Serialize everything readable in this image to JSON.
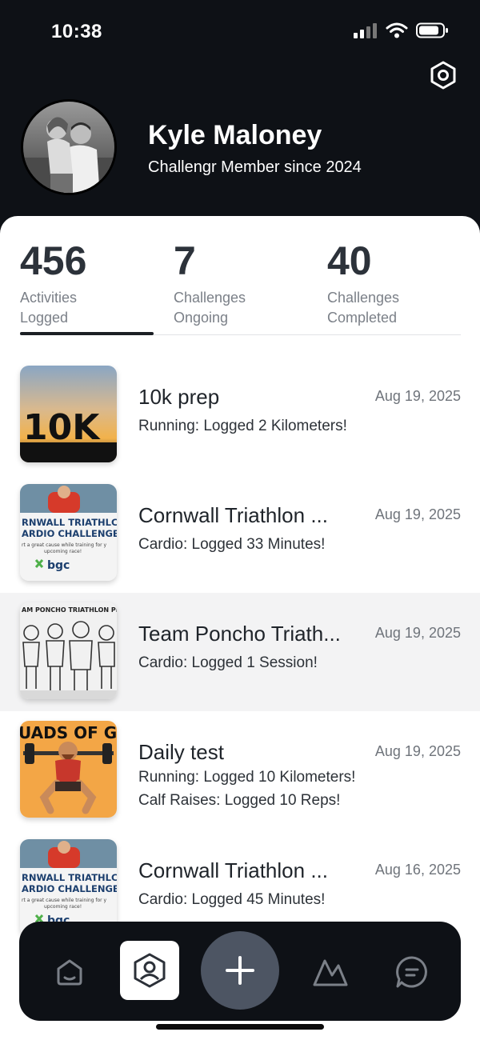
{
  "status_bar": {
    "time": "10:38"
  },
  "profile": {
    "name": "Kyle Maloney",
    "member_since": "Challengr Member since 2024"
  },
  "stats": [
    {
      "value": "456",
      "label": "Activities Logged"
    },
    {
      "value": "7",
      "label": "Challenges Ongoing"
    },
    {
      "value": "40",
      "label": "Challenges Completed"
    }
  ],
  "feed": [
    {
      "title": "10k prep",
      "date": "Aug 19, 2025",
      "lines": [
        "Running: Logged 2 Kilometers!"
      ],
      "thumb_text": "10K"
    },
    {
      "title": "Cornwall Triathlon ...",
      "date": "Aug 19, 2025",
      "lines": [
        "Cardio: Logged 33 Minutes!"
      ],
      "thumb_text": [
        "RNWALL TRIATHLC",
        "ARDIO CHALLENGE",
        "rt a great cause while training for y",
        "upcoming race!",
        "bgc"
      ]
    },
    {
      "title": "Team Poncho Triath...",
      "date": "Aug 19, 2025",
      "lines": [
        "Cardio: Logged 1 Session!"
      ],
      "thumb_text": "AM PONCHO TRIATHLON PR"
    },
    {
      "title": "Daily test",
      "date": "Aug 19, 2025",
      "lines": [
        "Running: Logged 10 Kilometers!",
        "Calf Raises: Logged 10 Reps!"
      ],
      "thumb_text": "UADS OF GOD"
    },
    {
      "title": "Cornwall Triathlon ...",
      "date": "Aug 16, 2025",
      "lines": [
        "Cardio: Logged 45 Minutes!"
      ],
      "thumb_text": [
        "RNWALL TRIATHLC",
        "ARDIO CHALLENGE",
        "rt a great cause while training for y",
        "upcoming race!",
        "bgc"
      ]
    }
  ],
  "bottom_nav": {
    "items": [
      {
        "icon": "home-icon"
      },
      {
        "icon": "profile-icon",
        "active": true
      },
      {
        "icon": "plus-icon"
      },
      {
        "icon": "mountain-icon"
      },
      {
        "icon": "chat-icon"
      }
    ]
  },
  "colors": {
    "header_bg": "#0e1116",
    "nav_bg": "#0e1116",
    "add_button": "#4d5563",
    "highlight_row": "#f3f3f4"
  }
}
